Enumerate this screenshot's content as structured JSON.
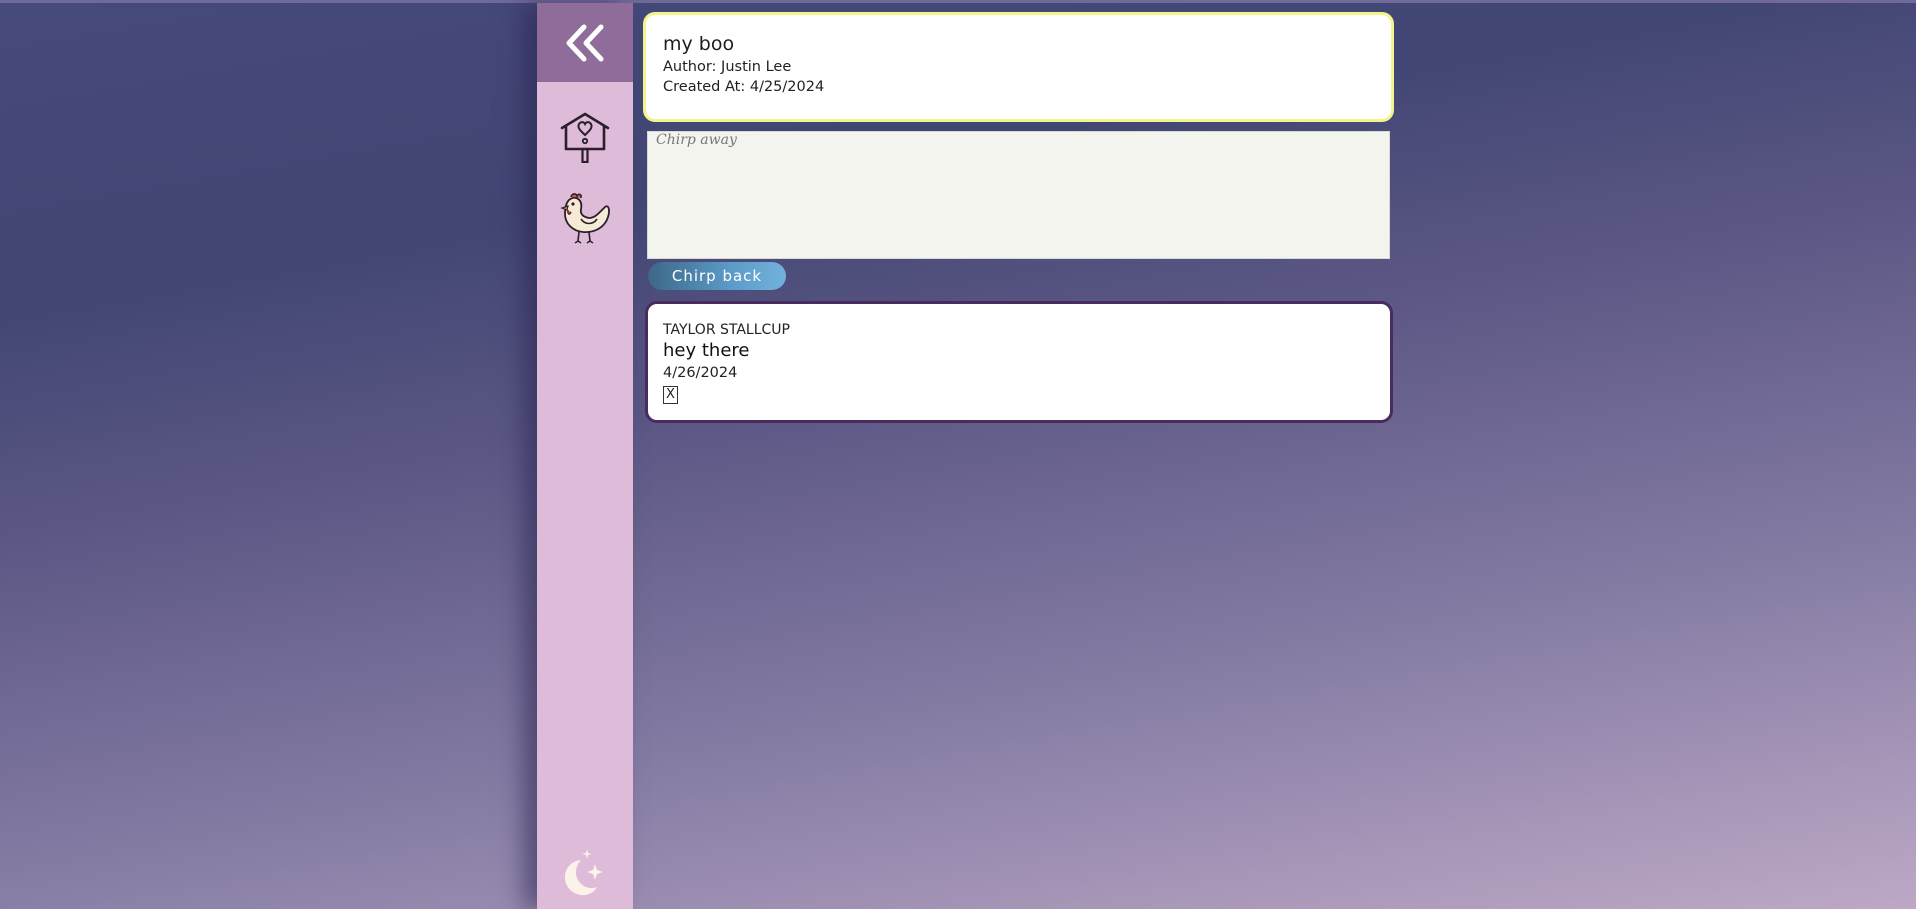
{
  "sidebar": {
    "collapse_icon": "double-chevron-left-icon",
    "items": [
      {
        "name": "birdhouse",
        "icon": "birdhouse-icon"
      },
      {
        "name": "chicken",
        "icon": "chicken-icon"
      }
    ],
    "theme_icon": "moon-stars-icon"
  },
  "post": {
    "title": "my boo",
    "author": "Author: Justin Lee",
    "created": "Created At: 4/25/2024"
  },
  "reply_form": {
    "placeholder": "Chirp away",
    "value": "",
    "submit_label": "Chirp back"
  },
  "replies": [
    {
      "author": "TAYLOR STALLCUP",
      "text": "hey there",
      "date": "4/26/2024",
      "delete_label": "X"
    }
  ],
  "colors": {
    "sidebar_bg": "#dfbbda",
    "sidebar_top_bg": "#8f6c99",
    "post_border": "#f4f48c",
    "reply_border": "#4a2b5e",
    "button_start": "#3d6787",
    "button_end": "#72b2dc",
    "bg_top": "#464a7c",
    "bg_bottom": "#bda8c6"
  }
}
